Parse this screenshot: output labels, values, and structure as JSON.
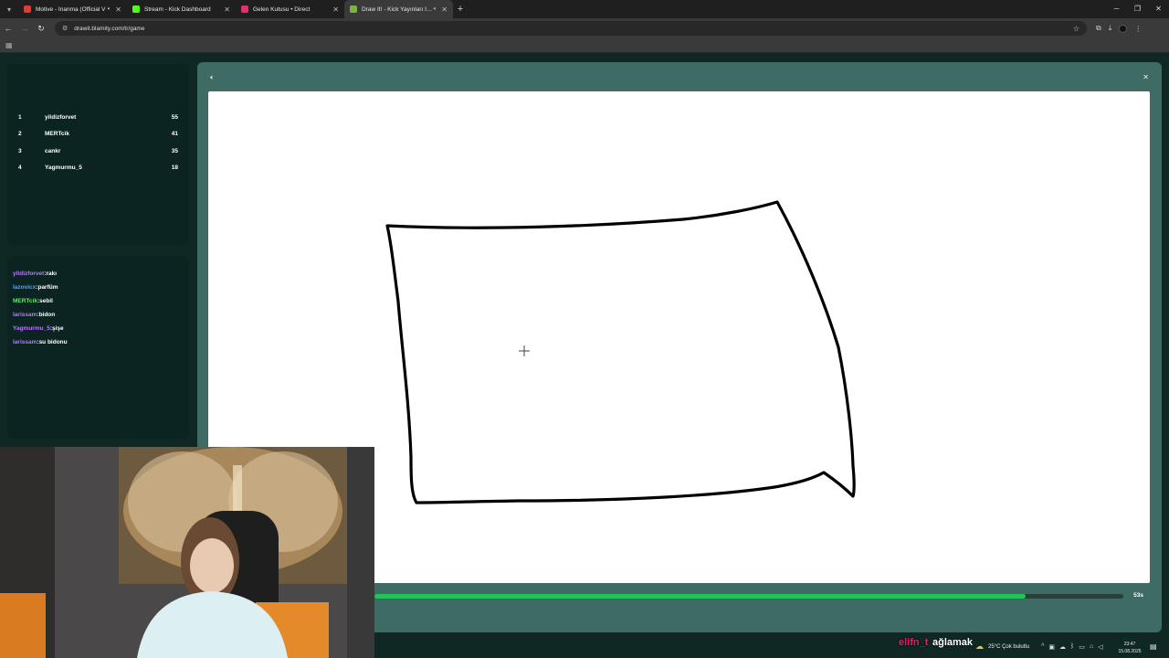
{
  "browser": {
    "tabs": [
      {
        "title": "Motive - İnanma (Official V",
        "favicon_color": "#e53935",
        "audio": true,
        "active": false
      },
      {
        "title": "Stream - Kick Dashboard",
        "favicon_color": "#53fc18",
        "audio": false,
        "active": false
      },
      {
        "title": "Gelen Kutusu • Direct",
        "favicon_color": "#e1306c",
        "audio": false,
        "active": false
      },
      {
        "title": "Draw It! - Kick Yayınları İçin",
        "favicon_color": "#7cb342",
        "audio": true,
        "active": true
      }
    ],
    "url": "drawit.blamity.com/tr/game"
  },
  "leaderboard": [
    {
      "rank": "1",
      "name": "yildizforvet",
      "score": "55"
    },
    {
      "rank": "2",
      "name": "MERTcik",
      "score": "41"
    },
    {
      "rank": "3",
      "name": "cankr",
      "score": "35"
    },
    {
      "rank": "4",
      "name": "Yagmurmu_5",
      "score": "18"
    }
  ],
  "chat": [
    {
      "user": "yildizforvet",
      "text": "rakı",
      "color": "#b57cf5"
    },
    {
      "user": "lazovicx",
      "text": "parfüm",
      "color": "#4aa8ff"
    },
    {
      "user": "MERTcik",
      "text": "sebil",
      "color": "#6ee07a"
    },
    {
      "user": "larissam",
      "text": "bidon",
      "color": "#b57cf5"
    },
    {
      "user": "Yagmurmu_5",
      "text": "şişe",
      "color": "#b57cf5"
    },
    {
      "user": "larissam",
      "text": "su bidonu",
      "color": "#b57cf5"
    }
  ],
  "game": {
    "timer": "53s",
    "progress": 0.87
  },
  "overlay": {
    "user": "elifn_t",
    "message": "ağlamak"
  },
  "taskbar": {
    "weather": "25°C  Çok bulutlu",
    "time": "23:47",
    "date": "15.08.2025"
  }
}
